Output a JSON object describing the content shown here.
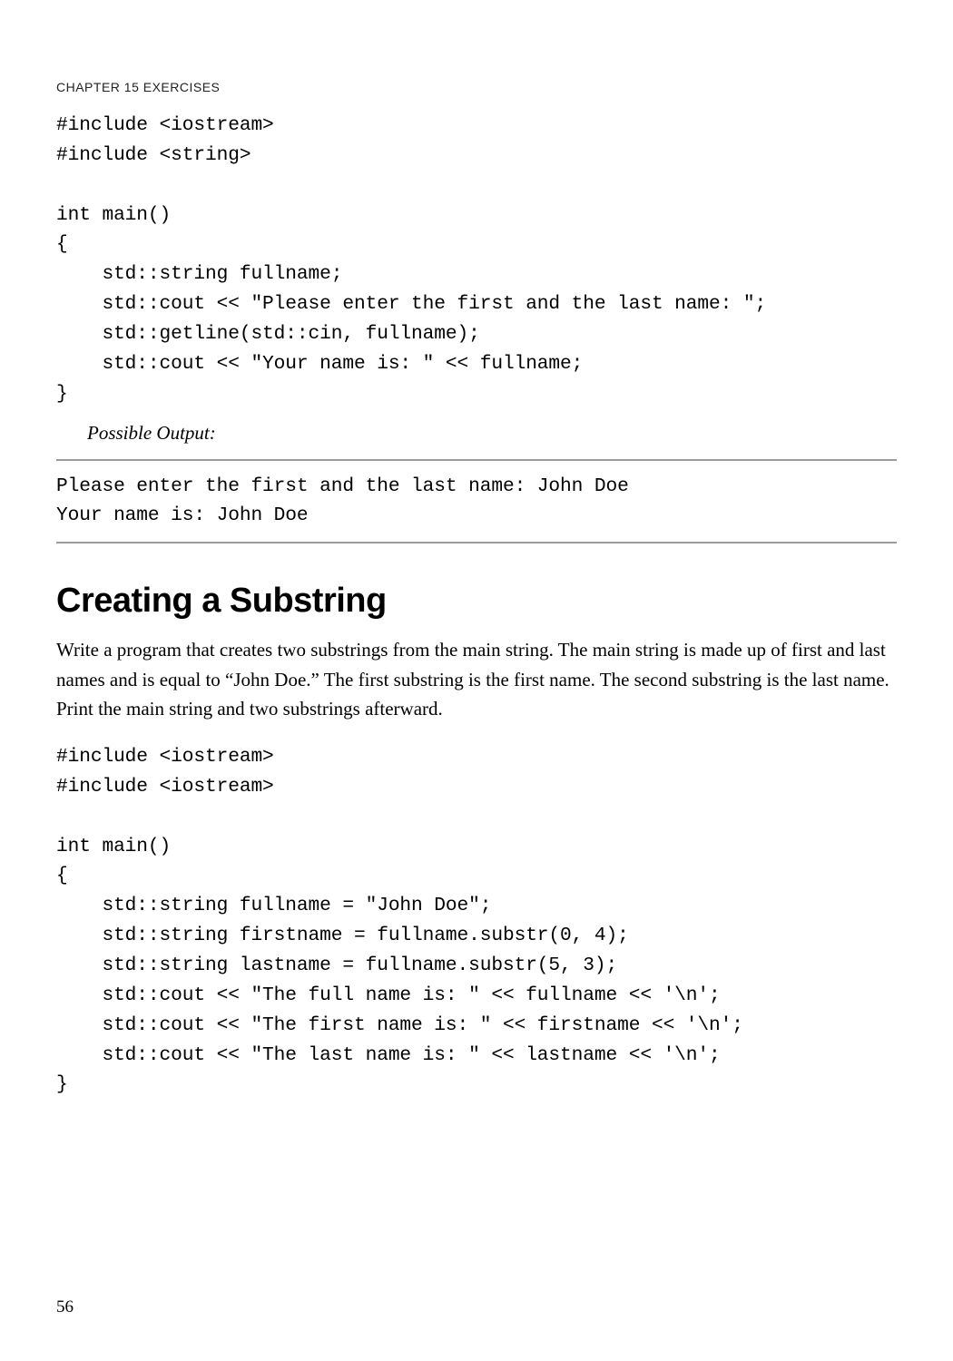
{
  "runningHead": "CHAPTER 15    EXERCISES",
  "code1": "#include <iostream>\n#include <string>\n\nint main()\n{\n    std::string fullname;\n    std::cout << \"Please enter the first and the last name: \";\n    std::getline(std::cin, fullname);\n    std::cout << \"Your name is: \" << fullname;\n}",
  "possibleOutputLabel": "Possible Output:",
  "output1": "Please enter the first and the last name: John Doe\nYour name is: John Doe",
  "heading": "Creating a Substring",
  "paragraph": "Write a program that creates two substrings from the main string. The main string is made up of first and last names and is equal to “John Doe.” The first substring is the first name. The second substring is the last name. Print the main string and two substrings afterward.",
  "code2": "#include <iostream>\n#include <iostream>\n\nint main()\n{\n    std::string fullname = \"John Doe\";\n    std::string firstname = fullname.substr(0, 4);\n    std::string lastname = fullname.substr(5, 3);\n    std::cout << \"The full name is: \" << fullname << '\\n';\n    std::cout << \"The first name is: \" << firstname << '\\n';\n    std::cout << \"The last name is: \" << lastname << '\\n';\n}",
  "pageNumber": "56"
}
